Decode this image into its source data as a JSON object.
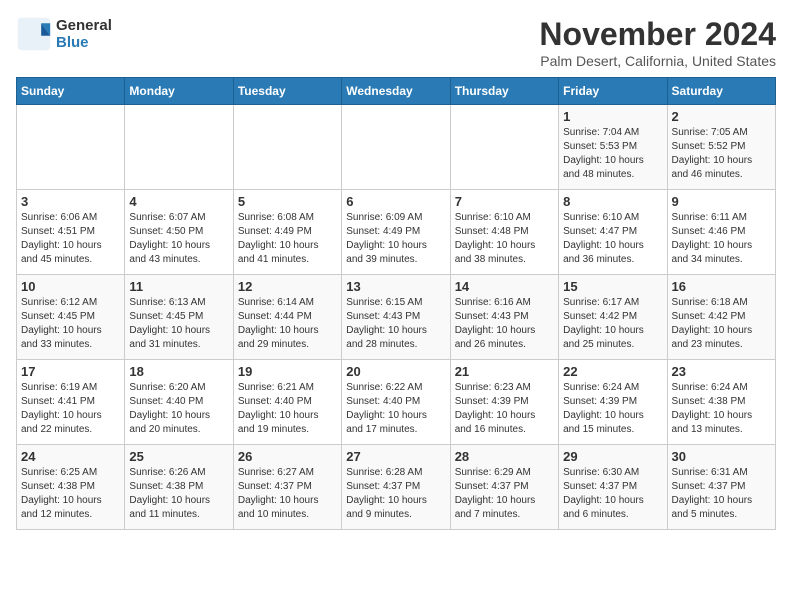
{
  "logo": {
    "line1": "General",
    "line2": "Blue"
  },
  "title": "November 2024",
  "location": "Palm Desert, California, United States",
  "days_header": [
    "Sunday",
    "Monday",
    "Tuesday",
    "Wednesday",
    "Thursday",
    "Friday",
    "Saturday"
  ],
  "weeks": [
    [
      {
        "day": "",
        "info": ""
      },
      {
        "day": "",
        "info": ""
      },
      {
        "day": "",
        "info": ""
      },
      {
        "day": "",
        "info": ""
      },
      {
        "day": "",
        "info": ""
      },
      {
        "day": "1",
        "info": "Sunrise: 7:04 AM\nSunset: 5:53 PM\nDaylight: 10 hours\nand 48 minutes."
      },
      {
        "day": "2",
        "info": "Sunrise: 7:05 AM\nSunset: 5:52 PM\nDaylight: 10 hours\nand 46 minutes."
      }
    ],
    [
      {
        "day": "3",
        "info": "Sunrise: 6:06 AM\nSunset: 4:51 PM\nDaylight: 10 hours\nand 45 minutes."
      },
      {
        "day": "4",
        "info": "Sunrise: 6:07 AM\nSunset: 4:50 PM\nDaylight: 10 hours\nand 43 minutes."
      },
      {
        "day": "5",
        "info": "Sunrise: 6:08 AM\nSunset: 4:49 PM\nDaylight: 10 hours\nand 41 minutes."
      },
      {
        "day": "6",
        "info": "Sunrise: 6:09 AM\nSunset: 4:49 PM\nDaylight: 10 hours\nand 39 minutes."
      },
      {
        "day": "7",
        "info": "Sunrise: 6:10 AM\nSunset: 4:48 PM\nDaylight: 10 hours\nand 38 minutes."
      },
      {
        "day": "8",
        "info": "Sunrise: 6:10 AM\nSunset: 4:47 PM\nDaylight: 10 hours\nand 36 minutes."
      },
      {
        "day": "9",
        "info": "Sunrise: 6:11 AM\nSunset: 4:46 PM\nDaylight: 10 hours\nand 34 minutes."
      }
    ],
    [
      {
        "day": "10",
        "info": "Sunrise: 6:12 AM\nSunset: 4:45 PM\nDaylight: 10 hours\nand 33 minutes."
      },
      {
        "day": "11",
        "info": "Sunrise: 6:13 AM\nSunset: 4:45 PM\nDaylight: 10 hours\nand 31 minutes."
      },
      {
        "day": "12",
        "info": "Sunrise: 6:14 AM\nSunset: 4:44 PM\nDaylight: 10 hours\nand 29 minutes."
      },
      {
        "day": "13",
        "info": "Sunrise: 6:15 AM\nSunset: 4:43 PM\nDaylight: 10 hours\nand 28 minutes."
      },
      {
        "day": "14",
        "info": "Sunrise: 6:16 AM\nSunset: 4:43 PM\nDaylight: 10 hours\nand 26 minutes."
      },
      {
        "day": "15",
        "info": "Sunrise: 6:17 AM\nSunset: 4:42 PM\nDaylight: 10 hours\nand 25 minutes."
      },
      {
        "day": "16",
        "info": "Sunrise: 6:18 AM\nSunset: 4:42 PM\nDaylight: 10 hours\nand 23 minutes."
      }
    ],
    [
      {
        "day": "17",
        "info": "Sunrise: 6:19 AM\nSunset: 4:41 PM\nDaylight: 10 hours\nand 22 minutes."
      },
      {
        "day": "18",
        "info": "Sunrise: 6:20 AM\nSunset: 4:40 PM\nDaylight: 10 hours\nand 20 minutes."
      },
      {
        "day": "19",
        "info": "Sunrise: 6:21 AM\nSunset: 4:40 PM\nDaylight: 10 hours\nand 19 minutes."
      },
      {
        "day": "20",
        "info": "Sunrise: 6:22 AM\nSunset: 4:40 PM\nDaylight: 10 hours\nand 17 minutes."
      },
      {
        "day": "21",
        "info": "Sunrise: 6:23 AM\nSunset: 4:39 PM\nDaylight: 10 hours\nand 16 minutes."
      },
      {
        "day": "22",
        "info": "Sunrise: 6:24 AM\nSunset: 4:39 PM\nDaylight: 10 hours\nand 15 minutes."
      },
      {
        "day": "23",
        "info": "Sunrise: 6:24 AM\nSunset: 4:38 PM\nDaylight: 10 hours\nand 13 minutes."
      }
    ],
    [
      {
        "day": "24",
        "info": "Sunrise: 6:25 AM\nSunset: 4:38 PM\nDaylight: 10 hours\nand 12 minutes."
      },
      {
        "day": "25",
        "info": "Sunrise: 6:26 AM\nSunset: 4:38 PM\nDaylight: 10 hours\nand 11 minutes."
      },
      {
        "day": "26",
        "info": "Sunrise: 6:27 AM\nSunset: 4:37 PM\nDaylight: 10 hours\nand 10 minutes."
      },
      {
        "day": "27",
        "info": "Sunrise: 6:28 AM\nSunset: 4:37 PM\nDaylight: 10 hours\nand 9 minutes."
      },
      {
        "day": "28",
        "info": "Sunrise: 6:29 AM\nSunset: 4:37 PM\nDaylight: 10 hours\nand 7 minutes."
      },
      {
        "day": "29",
        "info": "Sunrise: 6:30 AM\nSunset: 4:37 PM\nDaylight: 10 hours\nand 6 minutes."
      },
      {
        "day": "30",
        "info": "Sunrise: 6:31 AM\nSunset: 4:37 PM\nDaylight: 10 hours\nand 5 minutes."
      }
    ]
  ]
}
